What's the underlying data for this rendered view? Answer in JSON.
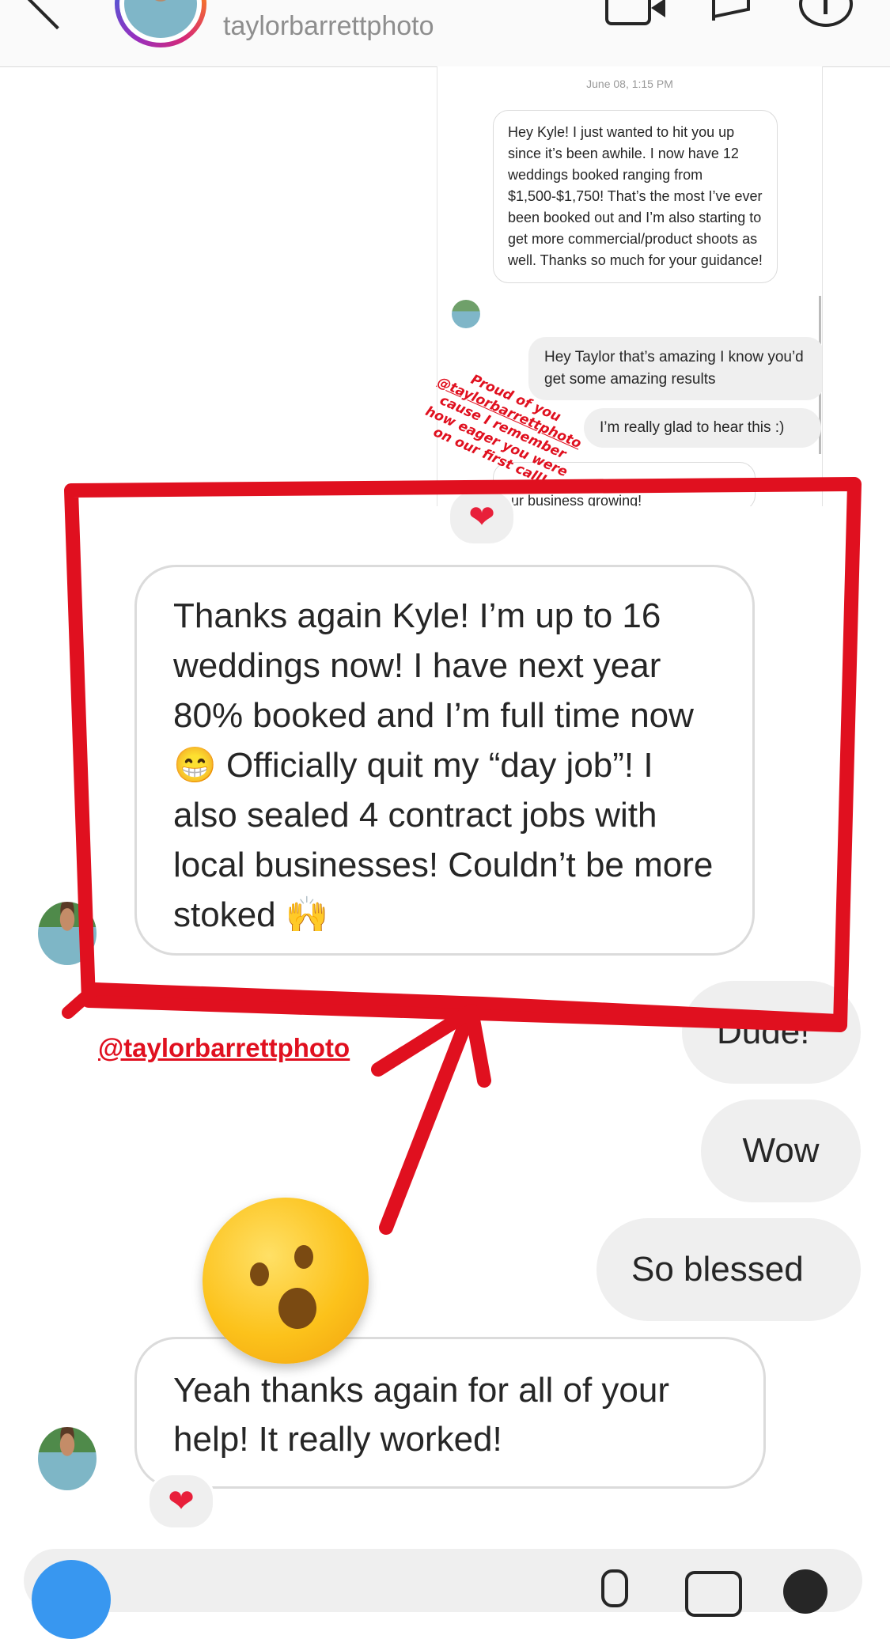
{
  "header": {
    "username": "taylorbarrettphoto"
  },
  "embedded_screenshot": {
    "timestamp": "June 08, 1:15 PM",
    "incoming_message": "Hey Kyle! I just wanted to hit you up since it’s been awhile. I now have 12 weddings booked ranging from $1,500-$1,750! That’s the most I’ve ever been booked out and I’m also starting to get more commercial/product shoots as well. Thanks so much for your guidance!",
    "reply_1": "Hey Taylor that’s amazing I know you’d get some amazing results",
    "reply_2": "I’m really glad to hear this :)",
    "reply_3_partial": "ur business growing!",
    "caption_line_1": "Proud of you",
    "caption_tag": "@taylorbarrettphoto",
    "caption_line_2": "cause I remember",
    "caption_line_3": "how eager you were",
    "caption_line_4": "on our first call!"
  },
  "reactions": {
    "heart": "❤"
  },
  "messages": {
    "big_incoming": "Thanks again Kyle! I’m up to 16 weddings now! I have next year 80% booked and I’m full time now 😁 Officially quit my “day job”! I also sealed 4 contract jobs with local businesses! Couldn’t be more stoked 🙌",
    "dude": "Dude!",
    "wow": "Wow",
    "so_blessed": "So blessed",
    "last_incoming": "Yeah thanks again for all of your help! It really worked!"
  },
  "annotations": {
    "tag": "@taylorbarrettphoto",
    "highlight_color": "#e0101f"
  },
  "icons": [
    "back-chevron-icon",
    "video-call-icon",
    "flag-icon",
    "info-icon",
    "camera-icon",
    "microphone-icon",
    "gallery-icon",
    "sticker-icon",
    "astonished-face-emoji"
  ]
}
